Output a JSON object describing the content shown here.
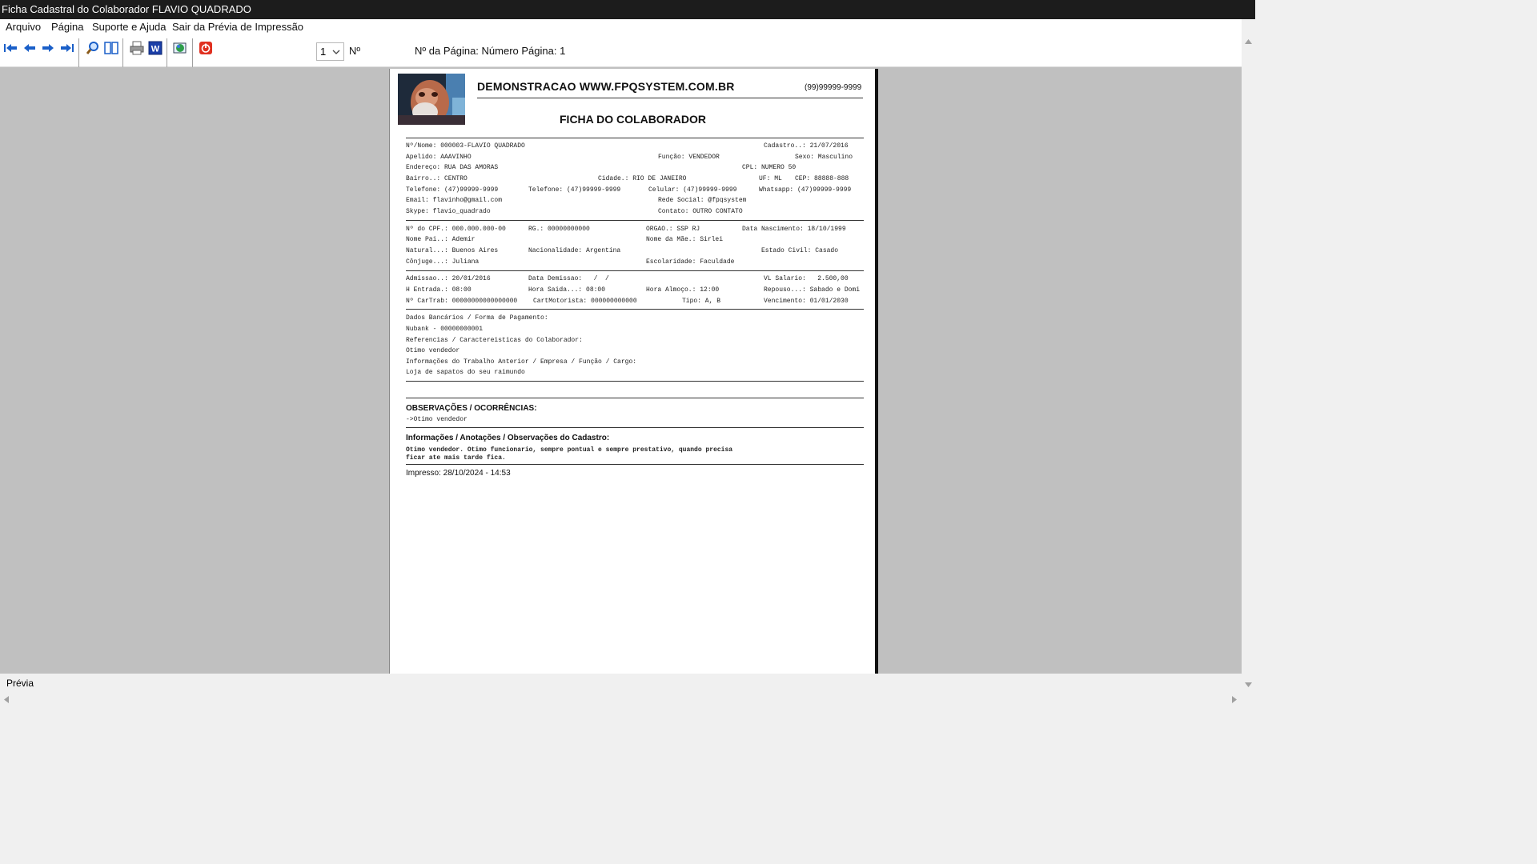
{
  "window": {
    "title": "Ficha Cadastral do Colaborador FLAVIO QUADRADO"
  },
  "menu": [
    {
      "label": "Arquivo"
    },
    {
      "label": "Página"
    },
    {
      "label": "Suporte e Ajuda"
    },
    {
      "label": "Sair da Prévia de Impressão"
    }
  ],
  "toolbar": {
    "buttons": [
      {
        "icon": "first-page-icon"
      },
      {
        "icon": "previous-page-icon"
      },
      {
        "icon": "next-page-icon"
      },
      {
        "icon": "last-page-icon"
      },
      {
        "icon": "zoom-icon"
      },
      {
        "icon": "page-layout-icon"
      },
      {
        "icon": "print-icon"
      },
      {
        "icon": "word-export-icon"
      },
      {
        "icon": "web-export-icon"
      },
      {
        "icon": "close-preview-icon"
      }
    ],
    "page_select_value": "1",
    "page_no_label": "Nº",
    "page_info": "Nº da Página: Número Página: 1"
  },
  "report": {
    "company": "DEMONSTRACAO WWW.FPQSYSTEM.COM.BR",
    "phone": "(99)99999-9999",
    "title": "FICHA DO COLABORADOR",
    "lines": {
      "nome": "Nº/Nome: 000003-FLAVIO QUADRADO",
      "cadastro": "Cadastro..: 21/07/2016",
      "apelido": "Apelido: AAAVINHO",
      "funcao": "Função: VENDEDOR",
      "sexo": "Sexo: Masculino",
      "endereco": "Endereço: RUA DAS AMORAS",
      "cpl": "CPL: NUMERO 50",
      "bairro": "Bairro..: CENTRO",
      "cidade": "Cidade.: RIO DE JANEIRO",
      "uf": "UF: ML",
      "cep": "CEP: 88888-888",
      "telefone1": "Telefone: (47)99999-9999",
      "telefone2": "Telefone: (47)99999-9999",
      "celular": "Celular: (47)99999-9999",
      "whatsapp": "Whatsapp: (47)99999-9999",
      "email": "Email: flavinho@gmail.com",
      "rede": "Rede Social: @fpqsystem",
      "skype": "Skype: flavio_quadrado",
      "contato": "Contato: OUTRO CONTATO",
      "cpf": "Nº do CPF.: 000.000.000-00",
      "rg": "RG.: 00000000000",
      "orgao": "ORGAO.: SSP RJ",
      "nascimento": "Data Nascimento: 18/10/1999",
      "pai": "Nome Pai..: Ademir",
      "mae": "Nome da Mãe.: Sirlei",
      "natural": "Natural...: Buenos Aires",
      "nacionalidade": "Nacionalidade: Argentina",
      "estado_civil": "Estado Civil: Casado",
      "conjuge": "Cônjuge...: Juliana",
      "escolaridade": "Escolaridade: Faculdade",
      "admissao": "Admissao..: 20/01/2016",
      "demissao": "Data Demissao:   /  /",
      "salario": "VL Salario:   2.500,00",
      "entrada": "H Entrada.: 08:00",
      "saida": "Hora Saida...: 08:00",
      "almoco": "Hora Almoço.: 12:00",
      "repouso": "Repouso...: Sabado e Domi",
      "cartrab": "Nº CarTrab: 00000000000000000",
      "cartmot": "CartMotorista: 000000000000",
      "tipo": "Tipo: A, B",
      "vencimento": "Vencimento: 01/01/2030",
      "bancarios_label": "Dados Bancários / Forma de Pagamento:",
      "bancarios": "Nubank - 00000000001",
      "referencias_label": "Referencias / Caractereisticas do Colaborador:",
      "referencias": "Otimo vendedor",
      "trabalho_label": "Informações do Trabalho Anterior / Empresa / Função / Cargo:",
      "trabalho": "Loja de sapatos do seu raimundo"
    },
    "obs_title": "OBSERVAÇÕES / OCORRÊNCIAS:",
    "obs_text": "->Otimo vendedor",
    "info_title": "Informações / Anotações / Observações do Cadastro:",
    "info_line1": "Otimo vendedor. Otimo funcionario, sempre pontual e sempre prestativo, quando precisa",
    "info_line2": "ficar ate mais tarde fica.",
    "impresso": "Impresso: 28/10/2024 - 14:53"
  },
  "status": {
    "text": "Prévia"
  },
  "colors": {
    "titlebar": "#1c1c1c",
    "preview_bg": "#c0c0c0",
    "toolbar_icon": "#1a5fc8"
  }
}
